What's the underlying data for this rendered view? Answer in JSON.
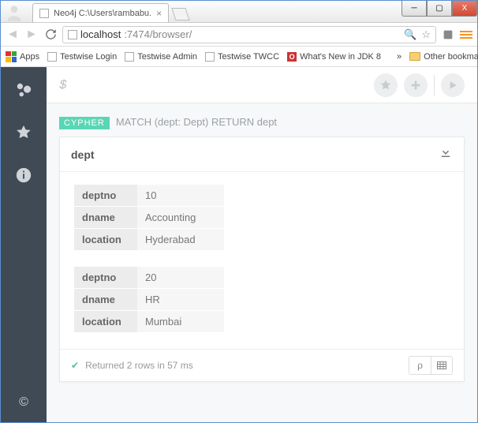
{
  "window": {
    "tab_title": "Neo4j C:\\Users\\rambabu.",
    "min": "—",
    "max": "□",
    "close": "X"
  },
  "url": {
    "host": "localhost",
    "port_path": ":7474/browser/"
  },
  "bookmarks": {
    "apps": "Apps",
    "items": [
      "Testwise Login",
      "Testwise Admin",
      "Testwise TWCC",
      "What's New in JDK 8"
    ],
    "chevron": "»",
    "other": "Other bookmarks"
  },
  "editor": {
    "prompt": "$"
  },
  "query": {
    "tag": "CYPHER",
    "text": "MATCH (dept: Dept) RETURN dept"
  },
  "card": {
    "title": "dept",
    "records": [
      {
        "deptno": "10",
        "dname": "Accounting",
        "location": "Hyderabad"
      },
      {
        "deptno": "20",
        "dname": "HR",
        "location": "Mumbai"
      }
    ],
    "labels": {
      "deptno": "deptno",
      "dname": "dname",
      "location": "location"
    },
    "status": "Returned 2 rows in 57 ms"
  }
}
